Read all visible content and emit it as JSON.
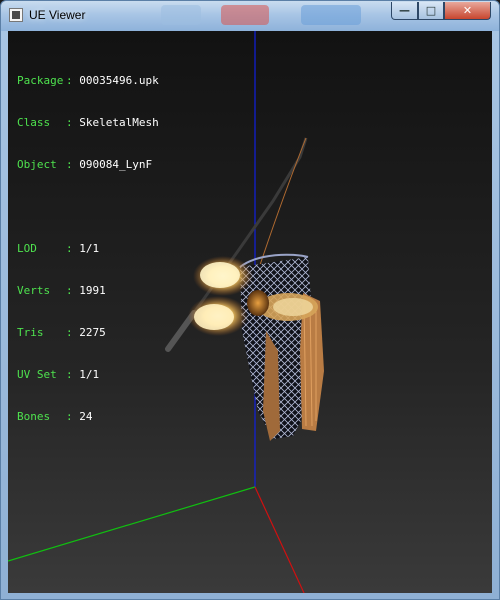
{
  "window": {
    "title": "UE Viewer",
    "controls": {
      "minimize": "—",
      "maximize": "□",
      "close": "✕"
    }
  },
  "info": {
    "package": {
      "label": "Package",
      "value": "00035496.upk"
    },
    "class": {
      "label": "Class",
      "value": "SkeletalMesh"
    },
    "object": {
      "label": "Object",
      "value": "090084_LynF"
    },
    "lod": {
      "label": "LOD",
      "value": "1/1"
    },
    "verts": {
      "label": "Verts",
      "value": "1991"
    },
    "tris": {
      "label": "Tris",
      "value": "2275"
    },
    "uvset": {
      "label": "UV Set",
      "value": "1/1"
    },
    "bones": {
      "label": "Bones",
      "value": "24"
    }
  },
  "scene": {
    "axis_colors": {
      "x": "#d01010",
      "y": "#10c010",
      "z": "#1020e0"
    },
    "background_top": "#121212",
    "background_bottom": "#3a3a3a"
  }
}
